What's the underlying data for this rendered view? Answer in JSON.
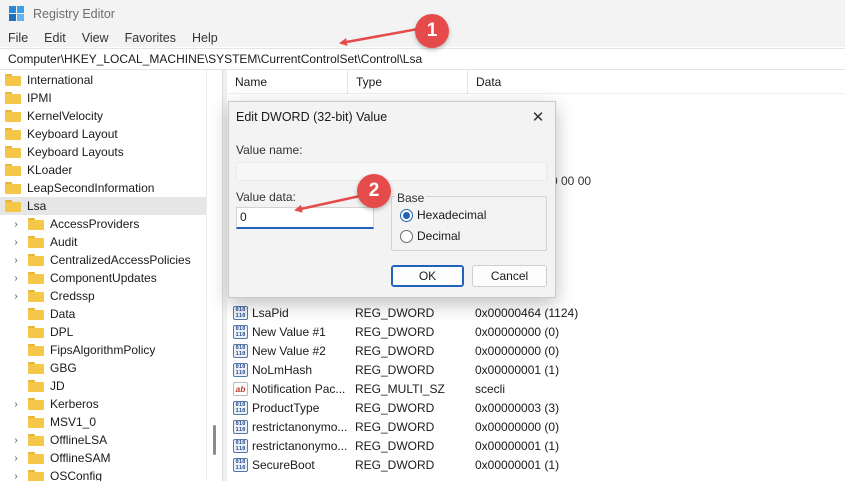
{
  "window": {
    "title": "Registry Editor"
  },
  "menu": [
    "File",
    "Edit",
    "View",
    "Favorites",
    "Help"
  ],
  "address": "Computer\\HKEY_LOCAL_MACHINE\\SYSTEM\\CurrentControlSet\\Control\\Lsa",
  "tree": {
    "items": [
      {
        "label": "International",
        "level": 0,
        "expandable": false,
        "selected": false
      },
      {
        "label": "IPMI",
        "level": 0,
        "expandable": false,
        "selected": false
      },
      {
        "label": "KernelVelocity",
        "level": 0,
        "expandable": false,
        "selected": false
      },
      {
        "label": "Keyboard Layout",
        "level": 0,
        "expandable": false,
        "selected": false
      },
      {
        "label": "Keyboard Layouts",
        "level": 0,
        "expandable": false,
        "selected": false
      },
      {
        "label": "KLoader",
        "level": 0,
        "expandable": false,
        "selected": false
      },
      {
        "label": "LeapSecondInformation",
        "level": 0,
        "expandable": false,
        "selected": false
      },
      {
        "label": "Lsa",
        "level": 0,
        "expandable": false,
        "selected": true
      },
      {
        "label": "AccessProviders",
        "level": 1,
        "expandable": true,
        "selected": false
      },
      {
        "label": "Audit",
        "level": 1,
        "expandable": true,
        "selected": false
      },
      {
        "label": "CentralizedAccessPolicies",
        "level": 1,
        "expandable": true,
        "selected": false
      },
      {
        "label": "ComponentUpdates",
        "level": 1,
        "expandable": true,
        "selected": false
      },
      {
        "label": "Credssp",
        "level": 1,
        "expandable": true,
        "selected": false
      },
      {
        "label": "Data",
        "level": 1,
        "expandable": false,
        "selected": false
      },
      {
        "label": "DPL",
        "level": 1,
        "expandable": false,
        "selected": false
      },
      {
        "label": "FipsAlgorithmPolicy",
        "level": 1,
        "expandable": false,
        "selected": false
      },
      {
        "label": "GBG",
        "level": 1,
        "expandable": false,
        "selected": false
      },
      {
        "label": "JD",
        "level": 1,
        "expandable": false,
        "selected": false
      },
      {
        "label": "Kerberos",
        "level": 1,
        "expandable": true,
        "selected": false
      },
      {
        "label": "MSV1_0",
        "level": 1,
        "expandable": false,
        "selected": false
      },
      {
        "label": "OfflineLSA",
        "level": 1,
        "expandable": true,
        "selected": false
      },
      {
        "label": "OfflineSAM",
        "level": 1,
        "expandable": true,
        "selected": false
      },
      {
        "label": "OSConfig",
        "level": 1,
        "expandable": true,
        "selected": false
      }
    ]
  },
  "list": {
    "columns": [
      "Name",
      "Type",
      "Data"
    ],
    "rows": [
      {
        "icon": "binary-value-icon",
        "name": "LsaPid",
        "type": "REG_DWORD",
        "data": "0x00000464 (1124)"
      },
      {
        "icon": "binary-value-icon",
        "name": "New Value #1",
        "type": "REG_DWORD",
        "data": "0x00000000 (0)"
      },
      {
        "icon": "binary-value-icon",
        "name": "New Value #2",
        "type": "REG_DWORD",
        "data": "0x00000000 (0)"
      },
      {
        "icon": "binary-value-icon",
        "name": "NoLmHash",
        "type": "REG_DWORD",
        "data": "0x00000001 (1)"
      },
      {
        "icon": "string-value-icon",
        "name": "Notification Pac...",
        "type": "REG_MULTI_SZ",
        "data": "scecli"
      },
      {
        "icon": "binary-value-icon",
        "name": "ProductType",
        "type": "REG_DWORD",
        "data": "0x00000003 (3)"
      },
      {
        "icon": "binary-value-icon",
        "name": "restrictanonymo...",
        "type": "REG_DWORD",
        "data": "0x00000000 (0)"
      },
      {
        "icon": "binary-value-icon",
        "name": "restrictanonymo...",
        "type": "REG_DWORD",
        "data": "0x00000001 (1)"
      },
      {
        "icon": "binary-value-icon",
        "name": "SecureBoot",
        "type": "REG_DWORD",
        "data": "0x00000001 (1)"
      }
    ],
    "peek_data": "0 00 00"
  },
  "dialog": {
    "title": "Edit DWORD (32-bit) Value",
    "close": "✕",
    "value_name_label": "Value name:",
    "value_name": "",
    "value_data_label": "Value data:",
    "value_data": "0",
    "base_label": "Base",
    "base_options": [
      {
        "label": "Hexadecimal",
        "checked": true
      },
      {
        "label": "Decimal",
        "checked": false
      }
    ],
    "ok_label": "OK",
    "cancel_label": "Cancel"
  },
  "callouts": [
    {
      "number": "1"
    },
    {
      "number": "2"
    }
  ],
  "colors": {
    "accent": "#1e63b6",
    "callout": "#e54b4b",
    "folder": "#f5c748"
  }
}
